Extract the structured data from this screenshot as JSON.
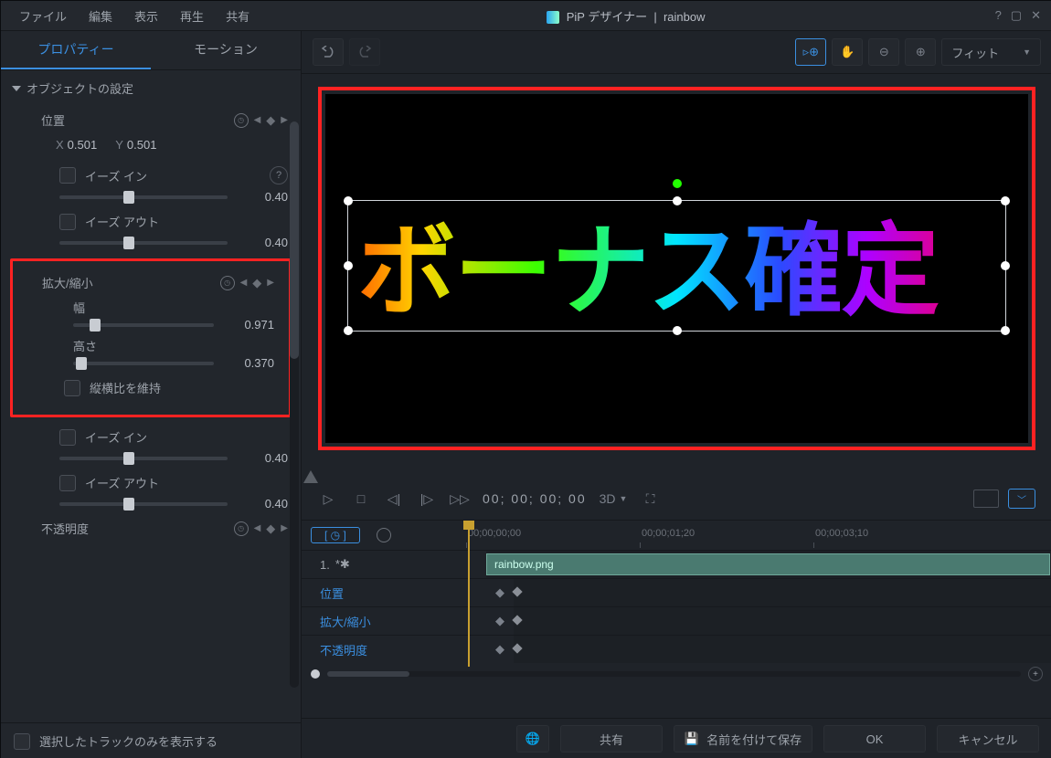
{
  "menu": {
    "file": "ファイル",
    "edit": "編集",
    "view": "表示",
    "play": "再生",
    "share": "共有"
  },
  "title": {
    "app": "PiP デザイナー",
    "sep": "|",
    "doc": "rainbow"
  },
  "tabs": {
    "property": "プロパティー",
    "motion": "モーション"
  },
  "section": {
    "object": "オブジェクトの設定"
  },
  "pos": {
    "label": "位置",
    "x_lbl": "X",
    "x": "0.501",
    "y_lbl": "Y",
    "y": "0.501"
  },
  "ease": {
    "in": "イーズ イン",
    "out": "イーズ アウト",
    "v1": "0.40",
    "v2": "0.40",
    "v3": "0.40",
    "v4": "0.40"
  },
  "scale": {
    "label": "拡大/縮小",
    "w_lbl": "幅",
    "w": "0.971",
    "h_lbl": "高さ",
    "h": "0.370",
    "lock": "縦横比を維持"
  },
  "opacity": {
    "label": "不透明度"
  },
  "leftbottom": {
    "only": "選択したトラックのみを表示する"
  },
  "fit": "フィット",
  "canvas": {
    "text": "ボーナス確定"
  },
  "playback": {
    "tc": "00; 00; 00; 00",
    "threeD": "3D"
  },
  "timeline": {
    "ruler": [
      "00;00;00;00",
      "00;00;01;20",
      "00;00;03;10"
    ],
    "track_num": "1.",
    "track_star": "*✱",
    "clip": "rainbow.png",
    "rows": [
      "位置",
      "拡大/縮小",
      "不透明度"
    ]
  },
  "footer": {
    "share": "共有",
    "saveas": "名前を付けて保存",
    "ok": "OK",
    "cancel": "キャンセル"
  }
}
